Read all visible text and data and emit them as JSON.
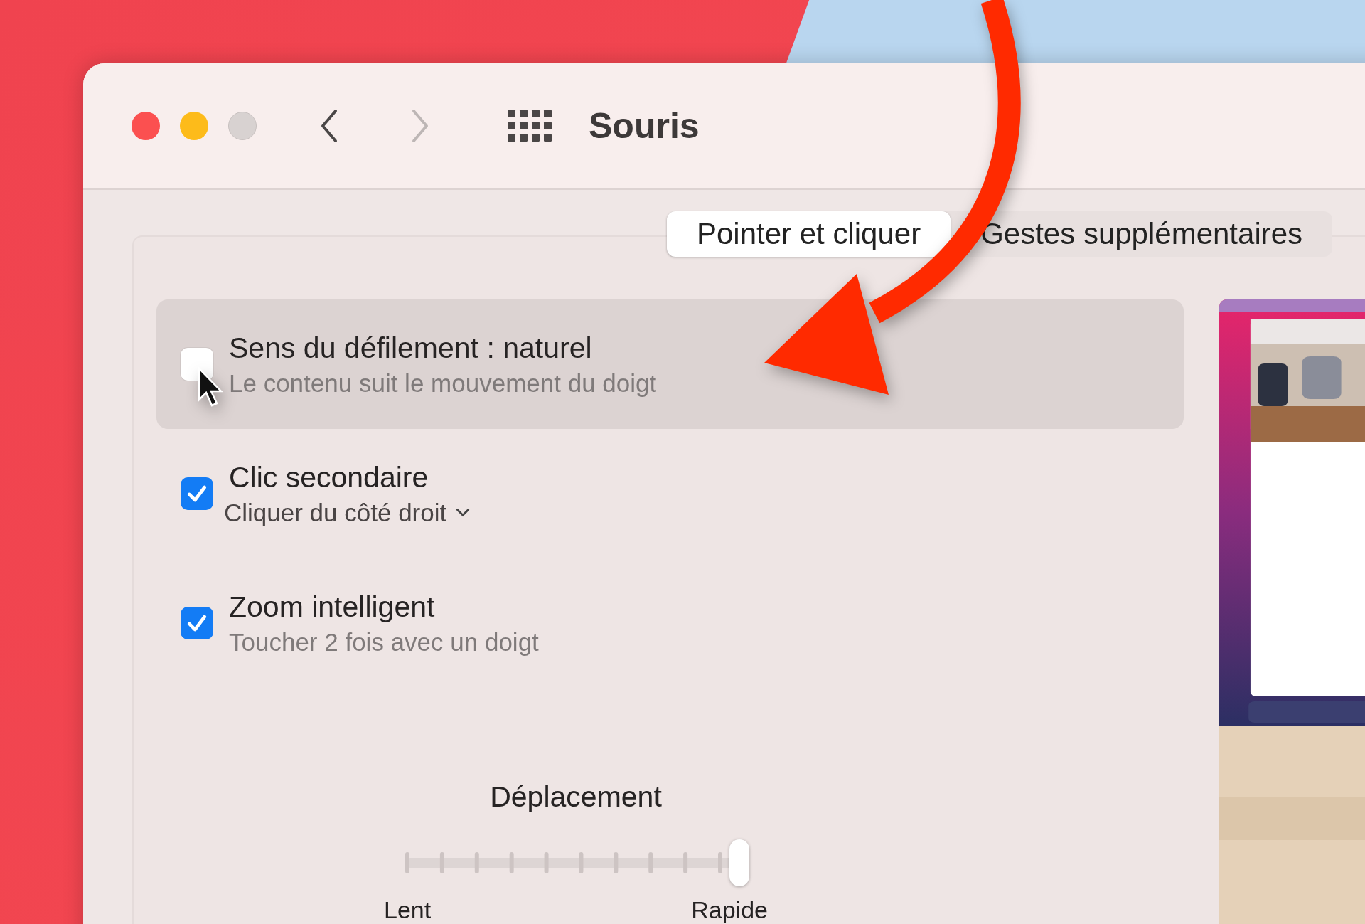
{
  "window": {
    "title": "Souris"
  },
  "navigation": {
    "back_disabled": false,
    "forward_disabled": true
  },
  "tabs": [
    {
      "label": "Pointer et cliquer",
      "selected": true
    },
    {
      "label": "Gestes supplémentaires",
      "selected": false
    }
  ],
  "options": [
    {
      "kind": "text",
      "title": "Sens du défilement : naturel",
      "detail": "Le contenu suit le mouvement du doigt",
      "checked": false,
      "highlighted": true
    },
    {
      "kind": "popup",
      "title": "Clic secondaire",
      "detail": "Cliquer du côté droit",
      "checked": true,
      "highlighted": false
    },
    {
      "kind": "text",
      "title": "Zoom intelligent",
      "detail": "Toucher 2 fois avec un doigt",
      "checked": true,
      "highlighted": false
    }
  ],
  "slider": {
    "label": "Déplacement",
    "level": 1,
    "min_label": "Lent",
    "max_label": "Rapide"
  }
}
